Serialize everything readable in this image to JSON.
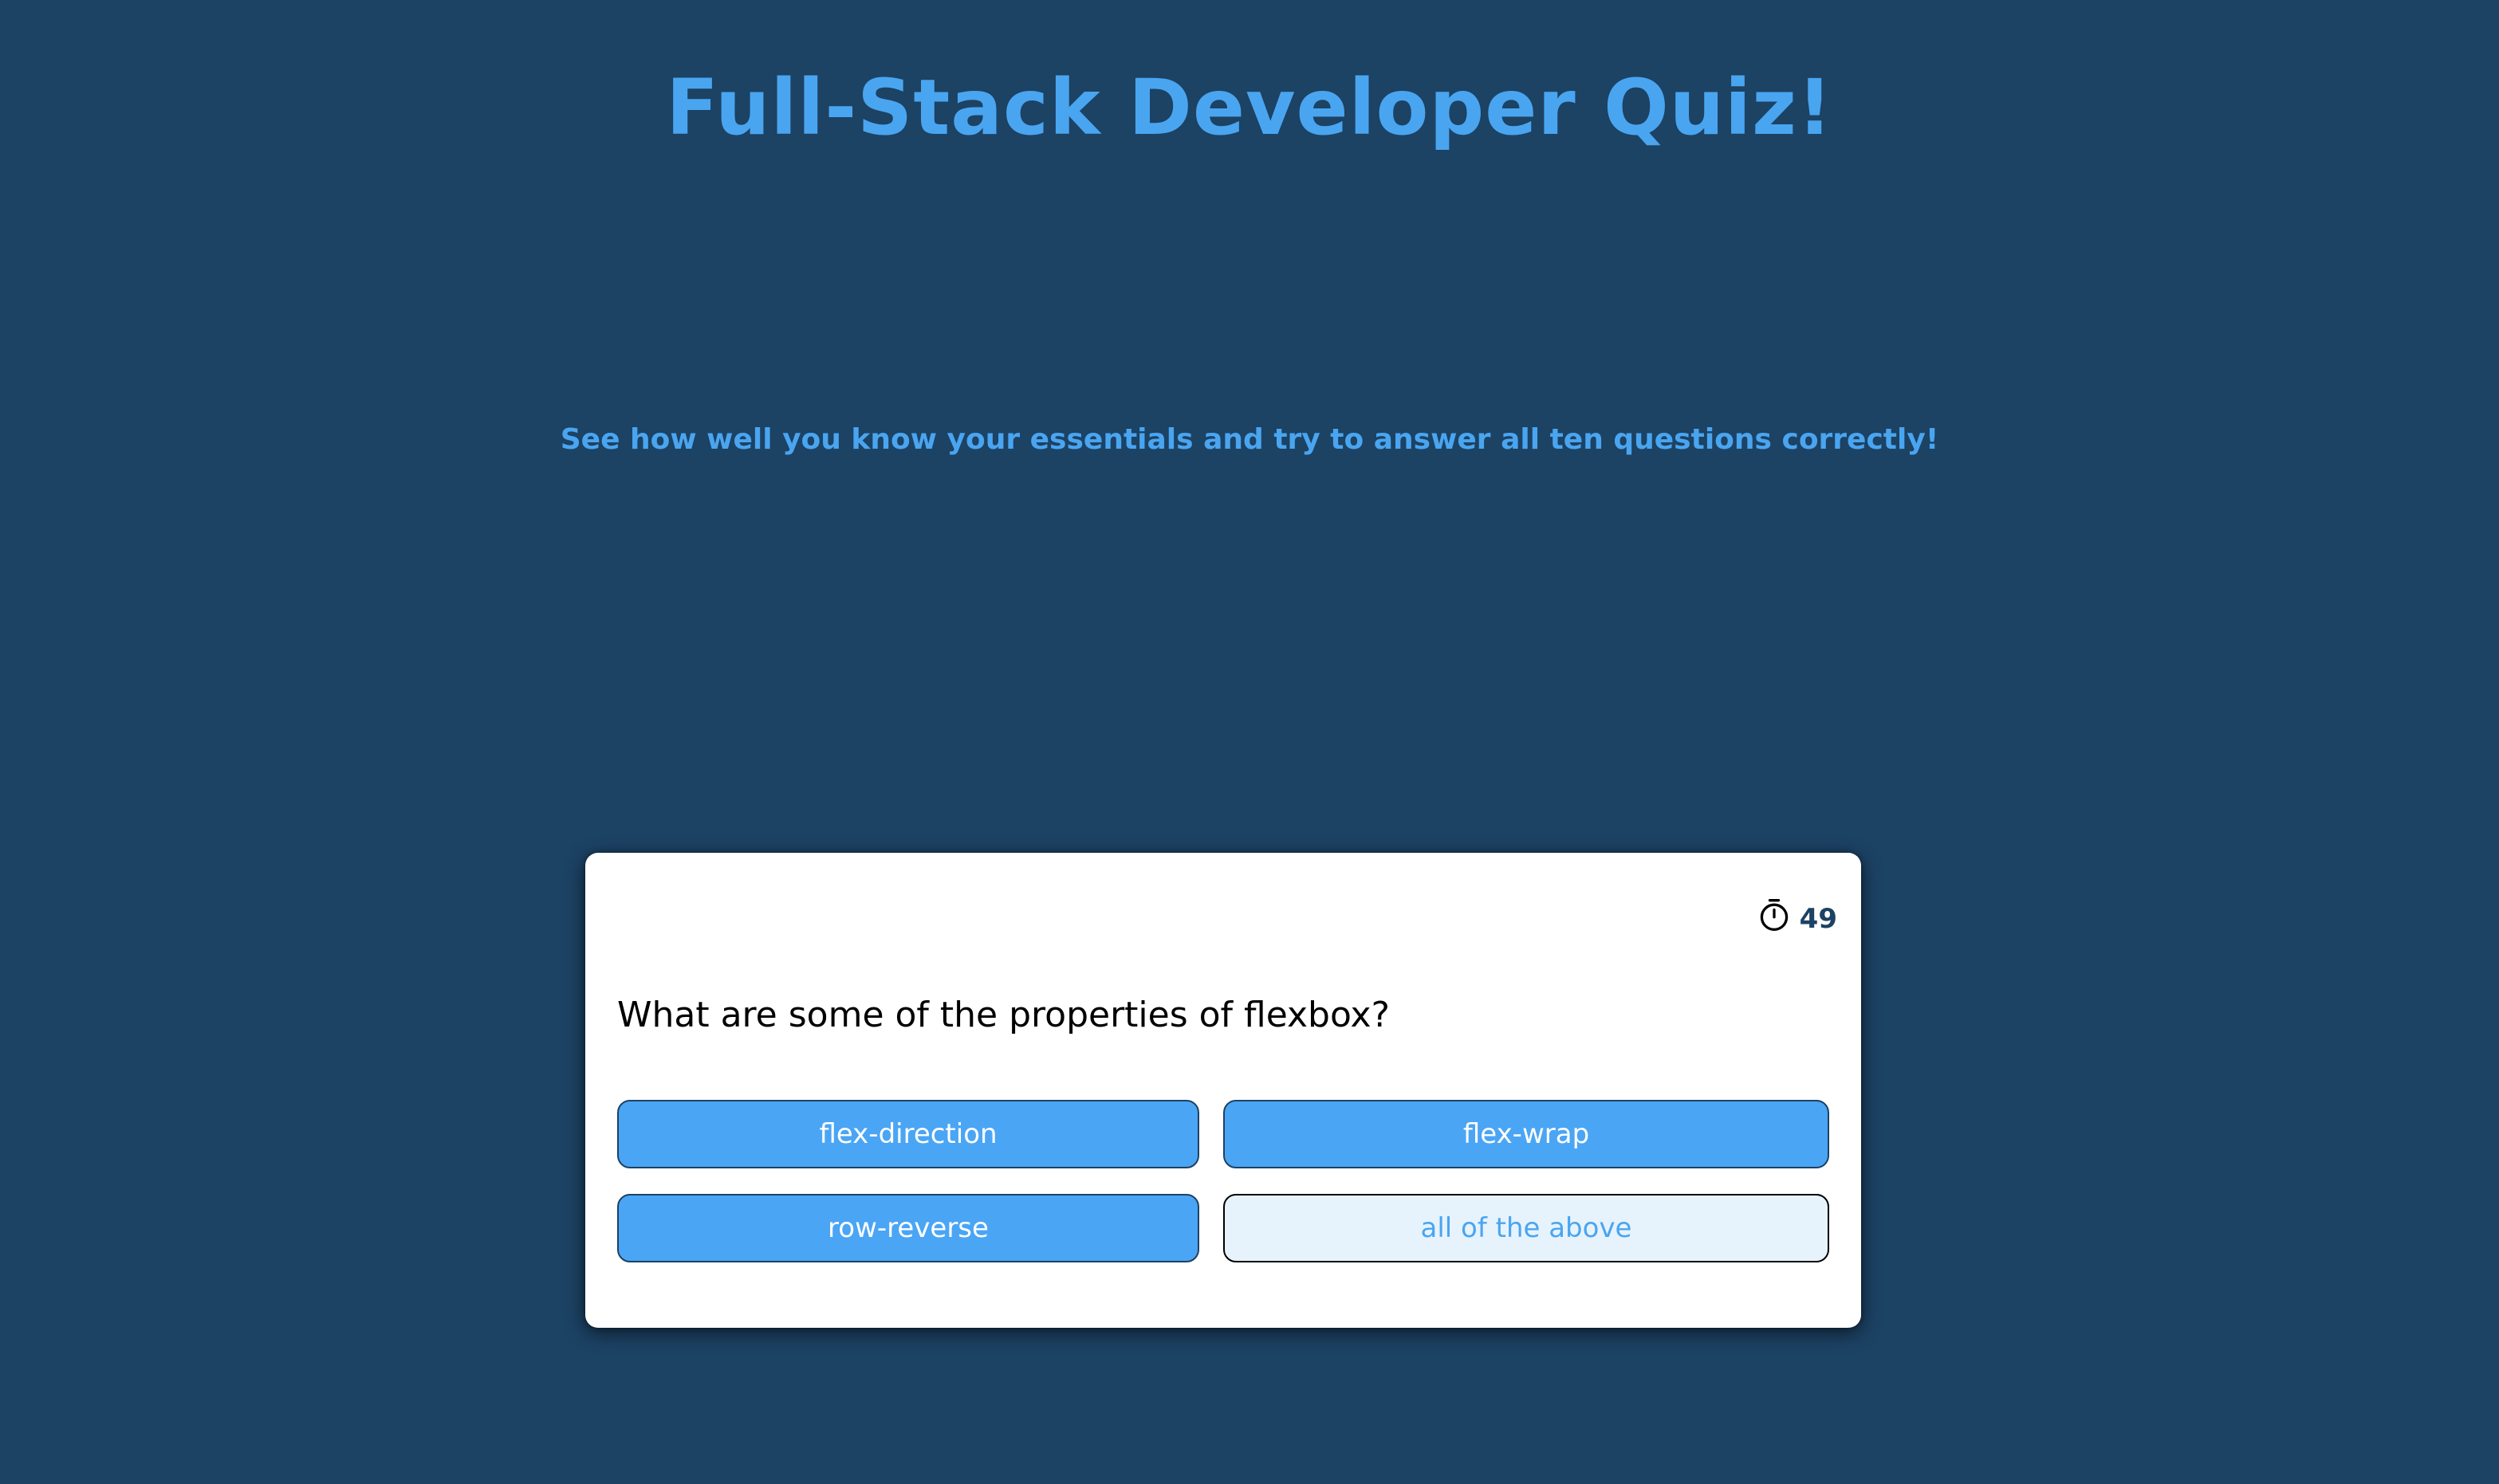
{
  "page": {
    "title": "Full-Stack Developer Quiz!",
    "subtitle": "See how well you know your essentials and try to answer all ten questions correctly!"
  },
  "quiz": {
    "timer_icon": "stopwatch-icon",
    "timer_value": "49",
    "question": "What are some of the properties of flexbox?",
    "answers": [
      {
        "label": "flex-direction",
        "state": "default"
      },
      {
        "label": "flex-wrap",
        "state": "default"
      },
      {
        "label": "row-reverse",
        "state": "default"
      },
      {
        "label": "all of the above",
        "state": "highlighted"
      }
    ]
  },
  "colors": {
    "background": "#1c4264",
    "accent": "#4aa5f0",
    "card": "#ffffff",
    "answer_button": "#4aa5f5",
    "answer_highlight": "#e6f3fd"
  }
}
